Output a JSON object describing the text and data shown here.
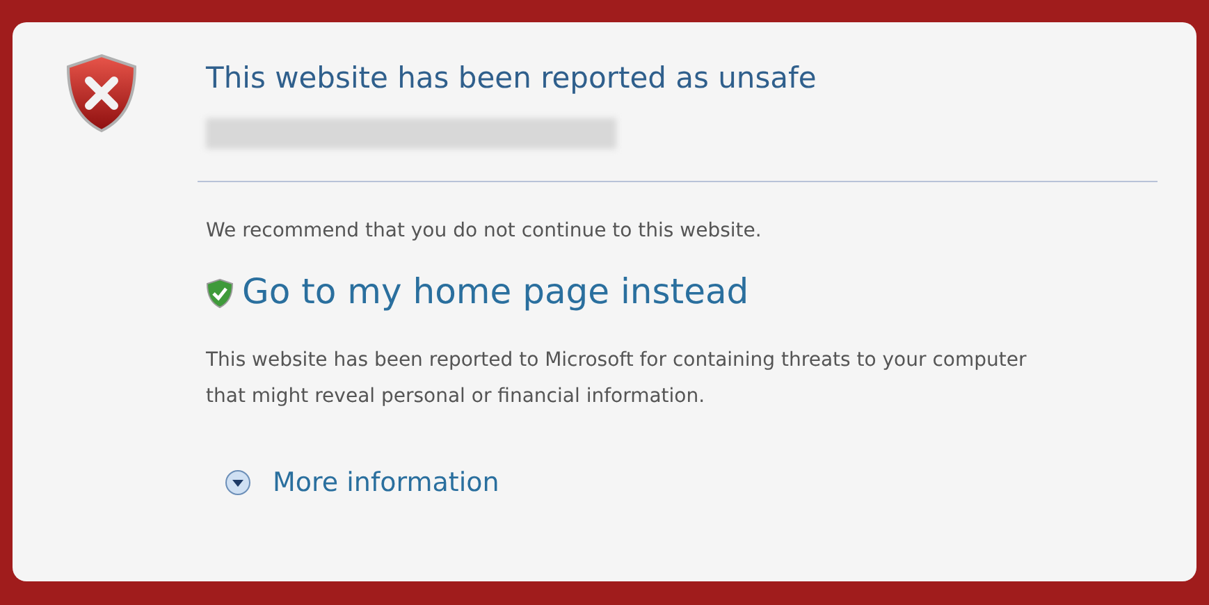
{
  "title": "This website has been reported as unsafe",
  "recommendation": "We recommend that you do not continue to this website.",
  "home_link": "Go to my home page instead",
  "explanation": "This website has been reported to Microsoft for containing threats to your computer that might reveal personal or financial information.",
  "more_info": {
    "label": "More information",
    "expanded": false
  }
}
